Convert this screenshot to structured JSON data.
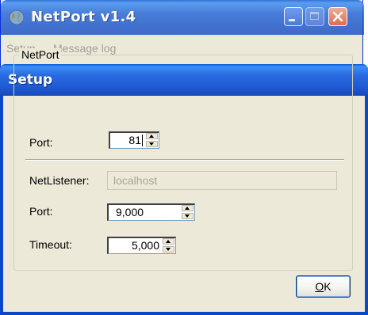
{
  "main_window": {
    "title": "NetPort v1.4",
    "menu": [
      "Setup",
      "Message log"
    ]
  },
  "dialog": {
    "title": "Setup",
    "group_label": "NetPort",
    "port_label": "Port:",
    "port_value": "81",
    "listener_label": "NetListener:",
    "listener_placeholder": "localhost",
    "listener_port_label": "Port:",
    "listener_port_value": "9,000",
    "timeout_label": "Timeout:",
    "timeout_value": "5,000",
    "ok_label_mnemonic": "O",
    "ok_label_rest": "K"
  },
  "colors": {
    "titlebar_blue": "#0b47c9",
    "dialog_face": "#ece9d8",
    "disabled_text": "#a8a69a"
  }
}
